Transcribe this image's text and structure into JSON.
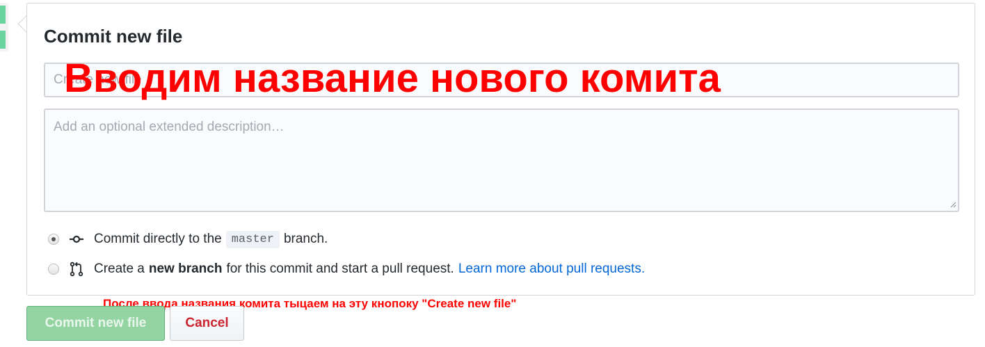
{
  "form": {
    "title": "Commit new file",
    "summary_placeholder": "Create new file",
    "description_placeholder": "Add an optional extended description…"
  },
  "options": {
    "direct": {
      "prefix": "Commit directly to the",
      "branch": "master",
      "suffix": "branch.",
      "selected": true
    },
    "new_branch": {
      "prefix": "Create a",
      "bold": "new branch",
      "suffix": "for this commit and start a pull request.",
      "link": "Learn more about pull requests.",
      "selected": false
    }
  },
  "buttons": {
    "commit_label": "Commit new file",
    "cancel_label": "Cancel"
  },
  "annotations": {
    "heading": "Вводим название нового комита",
    "note": "После ввода названия комита тыцаем на эту кнопоку \"Create new file\""
  },
  "colors": {
    "annotation": "#ff0000",
    "commit_button_bg": "#94d3a2",
    "cancel_text": "#cb2431",
    "link": "#0366d6"
  },
  "icons": {
    "direct": "git-commit-icon",
    "new_branch": "git-pull-request-icon"
  }
}
